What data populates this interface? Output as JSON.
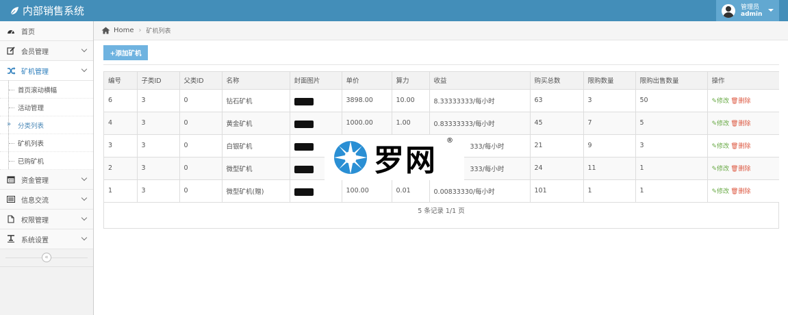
{
  "app": {
    "title": "内部销售系统"
  },
  "user": {
    "role": "管理员",
    "name": "admin"
  },
  "sidebar": {
    "items": [
      {
        "label": "首页",
        "icon": "dashboard-icon"
      },
      {
        "label": "会员管理",
        "icon": "edit-icon"
      },
      {
        "label": "矿机管理",
        "icon": "shuffle-icon"
      },
      {
        "label": "资金管理",
        "icon": "calendar-icon"
      },
      {
        "label": "信息交流",
        "icon": "list-icon"
      },
      {
        "label": "权限管理",
        "icon": "file-icon"
      },
      {
        "label": "系统设置",
        "icon": "text-width-icon"
      }
    ],
    "submenu": [
      "首页滚动横幅",
      "活动管理",
      "分类列表",
      "矿机列表",
      "已购矿机"
    ]
  },
  "breadcrumb": {
    "home": "Home",
    "current": "矿机列表"
  },
  "toolbar": {
    "add_label": "+添加矿机"
  },
  "table": {
    "headers": [
      "编号",
      "子类ID",
      "父类ID",
      "名称",
      "封面图片",
      "单价",
      "算力",
      "收益",
      "购买总数",
      "限购数量",
      "限购出售数量",
      "操作"
    ],
    "rows": [
      [
        "6",
        "3",
        "0",
        "钻石矿机",
        "",
        "3898.00",
        "10.00",
        "8.33333333/每小时",
        "63",
        "3",
        "50"
      ],
      [
        "4",
        "3",
        "0",
        "黄金矿机",
        "",
        "1000.00",
        "1.00",
        "0.83333333/每小时",
        "45",
        "7",
        "5"
      ],
      [
        "3",
        "3",
        "0",
        "白银矿机",
        "",
        "",
        "",
        "333/每小时",
        "21",
        "9",
        "3"
      ],
      [
        "2",
        "3",
        "0",
        "微型矿机",
        "",
        "",
        "",
        "333/每小时",
        "24",
        "11",
        "1"
      ],
      [
        "1",
        "3",
        "0",
        "微型矿机(赠)",
        "",
        "100.00",
        "0.01",
        "0.00833330/每小时",
        "101",
        "1",
        "1"
      ]
    ],
    "edit_label": "修改",
    "delete_label": "删除",
    "footer": "5 条记录 1/1 页"
  },
  "watermark": {
    "text": "罗网",
    "reg": "®"
  },
  "colors": {
    "topbar": "#438eb9",
    "accent": "#6fb3e0",
    "edit": "#69aa46",
    "delete": "#dd5a43"
  }
}
